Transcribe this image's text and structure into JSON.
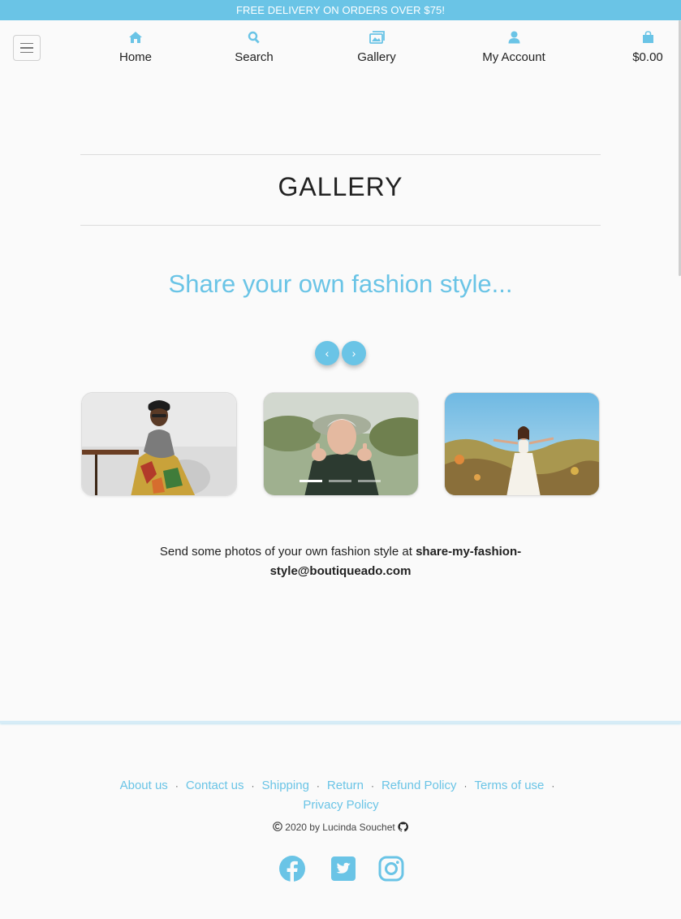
{
  "banner": {
    "text": "FREE DELIVERY ON ORDERS OVER $75!"
  },
  "nav": {
    "home": "Home",
    "search": "Search",
    "gallery": "Gallery",
    "account": "My Account",
    "bag_total": "$0.00"
  },
  "page": {
    "title": "GALLERY",
    "tagline": "Share your own fashion style..."
  },
  "carousel": {
    "prev": "‹",
    "next": "›",
    "slide_count": 3,
    "active_slide": 1
  },
  "send": {
    "prefix": "Send some photos of your own fashion style at ",
    "email": "share-my-fashion-style@boutiqueado.com"
  },
  "footer": {
    "links": [
      "About us",
      "Contact us",
      "Shipping",
      "Return",
      "Refund Policy",
      "Terms of use",
      "Privacy Policy"
    ],
    "separator": "·",
    "copyright": "2020 by Lucinda Souchet"
  },
  "colors": {
    "accent": "#6ac4e6",
    "background": "#fafafa",
    "text": "#222222"
  },
  "icons": [
    "home-icon",
    "search-icon",
    "gallery-icon",
    "user-icon",
    "shopping-bag-icon",
    "facebook-icon",
    "twitter-icon",
    "instagram-icon",
    "github-icon",
    "copyright-icon"
  ]
}
